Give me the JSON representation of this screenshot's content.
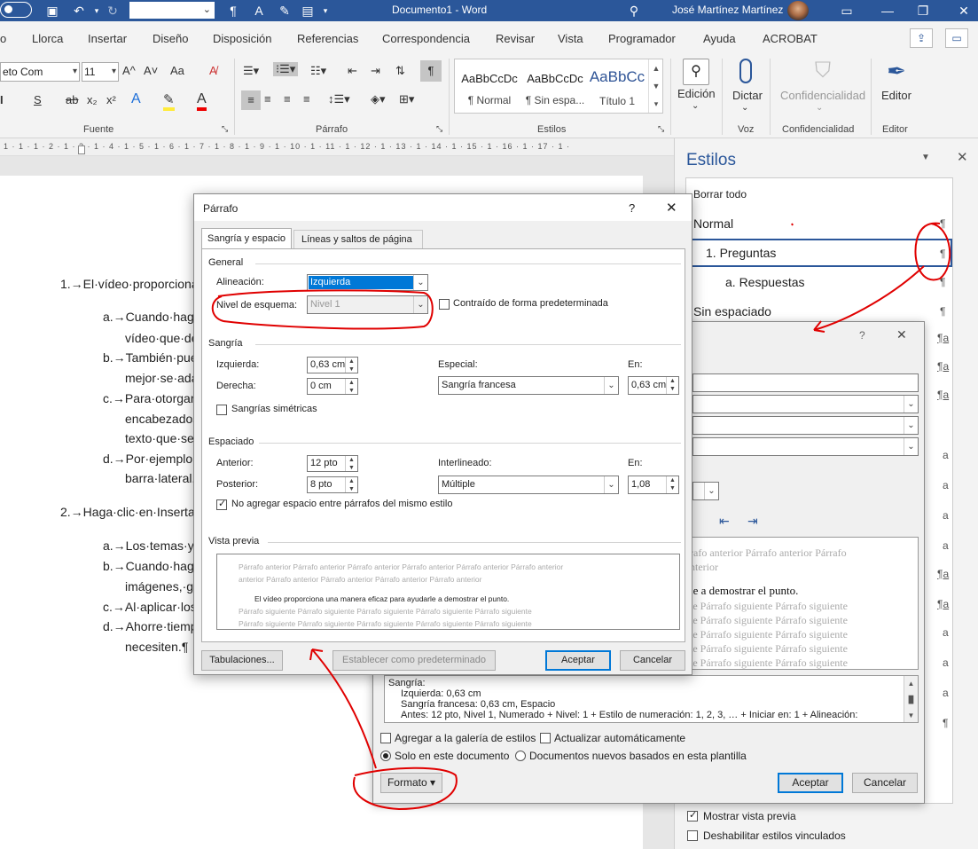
{
  "titlebar": {
    "doc_title": "Documento1 - Word",
    "user_name": "José Martínez Martínez"
  },
  "tabs": [
    "o",
    "Llorca",
    "Insertar",
    "Diseño",
    "Disposición",
    "Referencias",
    "Correspondencia",
    "Revisar",
    "Vista",
    "Programador",
    "Ayuda",
    "ACROBAT"
  ],
  "ribbon": {
    "font_name": "eto Com",
    "font_size": "11",
    "grow_font": "A^",
    "shrink_font": "A˅",
    "change_case": "Aa",
    "groups": {
      "font": "Fuente",
      "paragraph": "Párrafo",
      "styles": "Estilos",
      "voice": "Voz",
      "confidentiality": "Confidencialidad",
      "editor": "Editor"
    },
    "style_gallery": [
      {
        "preview": "AaBbCcDc",
        "name": "¶ Normal"
      },
      {
        "preview": "AaBbCcDc",
        "name": "¶ Sin espa..."
      },
      {
        "preview": "AaBbCc",
        "name": "Título 1"
      }
    ],
    "edit_label": "Edición",
    "dictate_label": "Dictar",
    "confidential_label": "Confidencialidad",
    "editor_label": "Editor"
  },
  "ruler_text": "1 · 1 · 1 · 2 · 1 · 3 · 1 · 4 · 1 · 5 · 1 · 6 · 1 · 7 · 1 · 8 · 1 · 9 · 1 · 10 · 1 · 11 · 1 · 12 · 1 · 13 · 1 · 14 · 1 · 15 · 1 · 16 · 1 · 17 · 1 ·",
  "document_lines": [
    "1.→El·vídeo·proporciona·",
    "a.→Cuando·haga",
    "vídeo·que·de",
    "b.→También·pue",
    "mejor·se·ada",
    "c.→Para·otorgar",
    "encabezados",
    "texto·que·se·",
    "d.→Por·ejemplo,·",
    "barra·lateral.",
    "2.→Haga·clic·en·Insertar·",
    "a.→Los·temas·y·e",
    "b.→Cuando·haga",
    "imágenes,·gr",
    "c.→Al·aplicar·los·",
    "d.→Ahorre·tiemp",
    "necesiten.¶"
  ],
  "styles_pane": {
    "title": "Estilos",
    "clear_all": "Borrar todo",
    "items": [
      {
        "label": "Normal",
        "mark": "¶"
      },
      {
        "label": "1.  Preguntas",
        "mark": "¶"
      },
      {
        "label": "a.  Respuestas",
        "mark": "¶"
      },
      {
        "label": "Sin espaciado",
        "mark": "¶"
      }
    ],
    "side_marks": [
      "¶a",
      "¶a",
      "¶a",
      "a",
      "a",
      "a",
      "a",
      "¶a",
      "¶a",
      "a",
      "a",
      "a",
      "¶"
    ],
    "show_preview": "Mostrar vista previa",
    "disable_linked": "Deshabilitar estilos vinculados"
  },
  "modify_dialog": {
    "help": "?",
    "close": "✕",
    "preview_lines": [
      "rafo anterior Párrafo anterior Párrafo",
      "nterior",
      "le a demostrar el punto.",
      "te Párrafo siguiente Párrafo siguiente",
      "te Párrafo siguiente Párrafo siguiente",
      "te Párrafo siguiente Párrafo siguiente",
      "te Párrafo siguiente Párrafo siguiente",
      "te Párrafo siguiente Párrafo siguiente"
    ],
    "description": [
      "Sangría:",
      "Izquierda:  0,63 cm",
      "Sangría francesa:  0,63 cm, Espacio",
      "Antes:  12 pto, Nivel 1, Numerado + Nivel: 1 + Estilo de numeración: 1, 2, 3, … + Iniciar en: 1 + Alineación:"
    ],
    "add_gallery": "Agregar a la galería de estilos",
    "auto_update": "Actualizar automáticamente",
    "only_doc": "Solo en este documento",
    "new_docs": "Documentos nuevos basados en esta plantilla",
    "format": "Formato ▾",
    "ok": "Aceptar",
    "cancel": "Cancelar"
  },
  "paragraph_dialog": {
    "title": "Párrafo",
    "help": "?",
    "close": "✕",
    "tab1": "Sangría y espacio",
    "tab2": "Líneas y saltos de página",
    "general": "General",
    "alignment_label": "Alineación:",
    "alignment_value": "Izquierda",
    "outline_label": "Nivel de esquema:",
    "outline_value": "Nivel 1",
    "collapsed_label": "Contraído de forma predeterminada",
    "indent": "Sangría",
    "left_label": "Izquierda:",
    "left_value": "0,63 cm",
    "right_label": "Derecha:",
    "right_value": "0 cm",
    "special_label": "Especial:",
    "special_value": "Sangría francesa",
    "by_label": "En:",
    "by_value": "0,63 cm",
    "mirror_label": "Sangrías simétricas",
    "spacing": "Espaciado",
    "before_label": "Anterior:",
    "before_value": "12 pto",
    "after_label": "Posterior:",
    "after_value": "8 pto",
    "line_label": "Interlineado:",
    "line_value": "Múltiple",
    "at_label": "En:",
    "at_value": "1,08",
    "no_space_label": "No agregar espacio entre párrafos del mismo estilo",
    "preview": "Vista previa",
    "preview_lines": [
      "Párrafo anterior Párrafo anterior Párrafo anterior Párrafo anterior Párrafo anterior Párrafo anterior",
      "anterior Párrafo anterior Párrafo anterior Párrafo anterior Párrafo anterior",
      "El vídeo proporciona una manera eficaz para ayudarle a demostrar el punto.",
      "Párrafo siguiente Párrafo siguiente Párrafo siguiente Párrafo siguiente Párrafo siguiente",
      "Párrafo siguiente Párrafo siguiente Párrafo siguiente Párrafo siguiente Párrafo siguiente"
    ],
    "tabs_btn": "Tabulaciones...",
    "default_btn": "Establecer como predeterminado",
    "ok": "Aceptar",
    "cancel": "Cancelar"
  },
  "colors": {
    "word_blue": "#2b579a",
    "annotation_red": "#e00000",
    "selection": "#0078d7"
  }
}
